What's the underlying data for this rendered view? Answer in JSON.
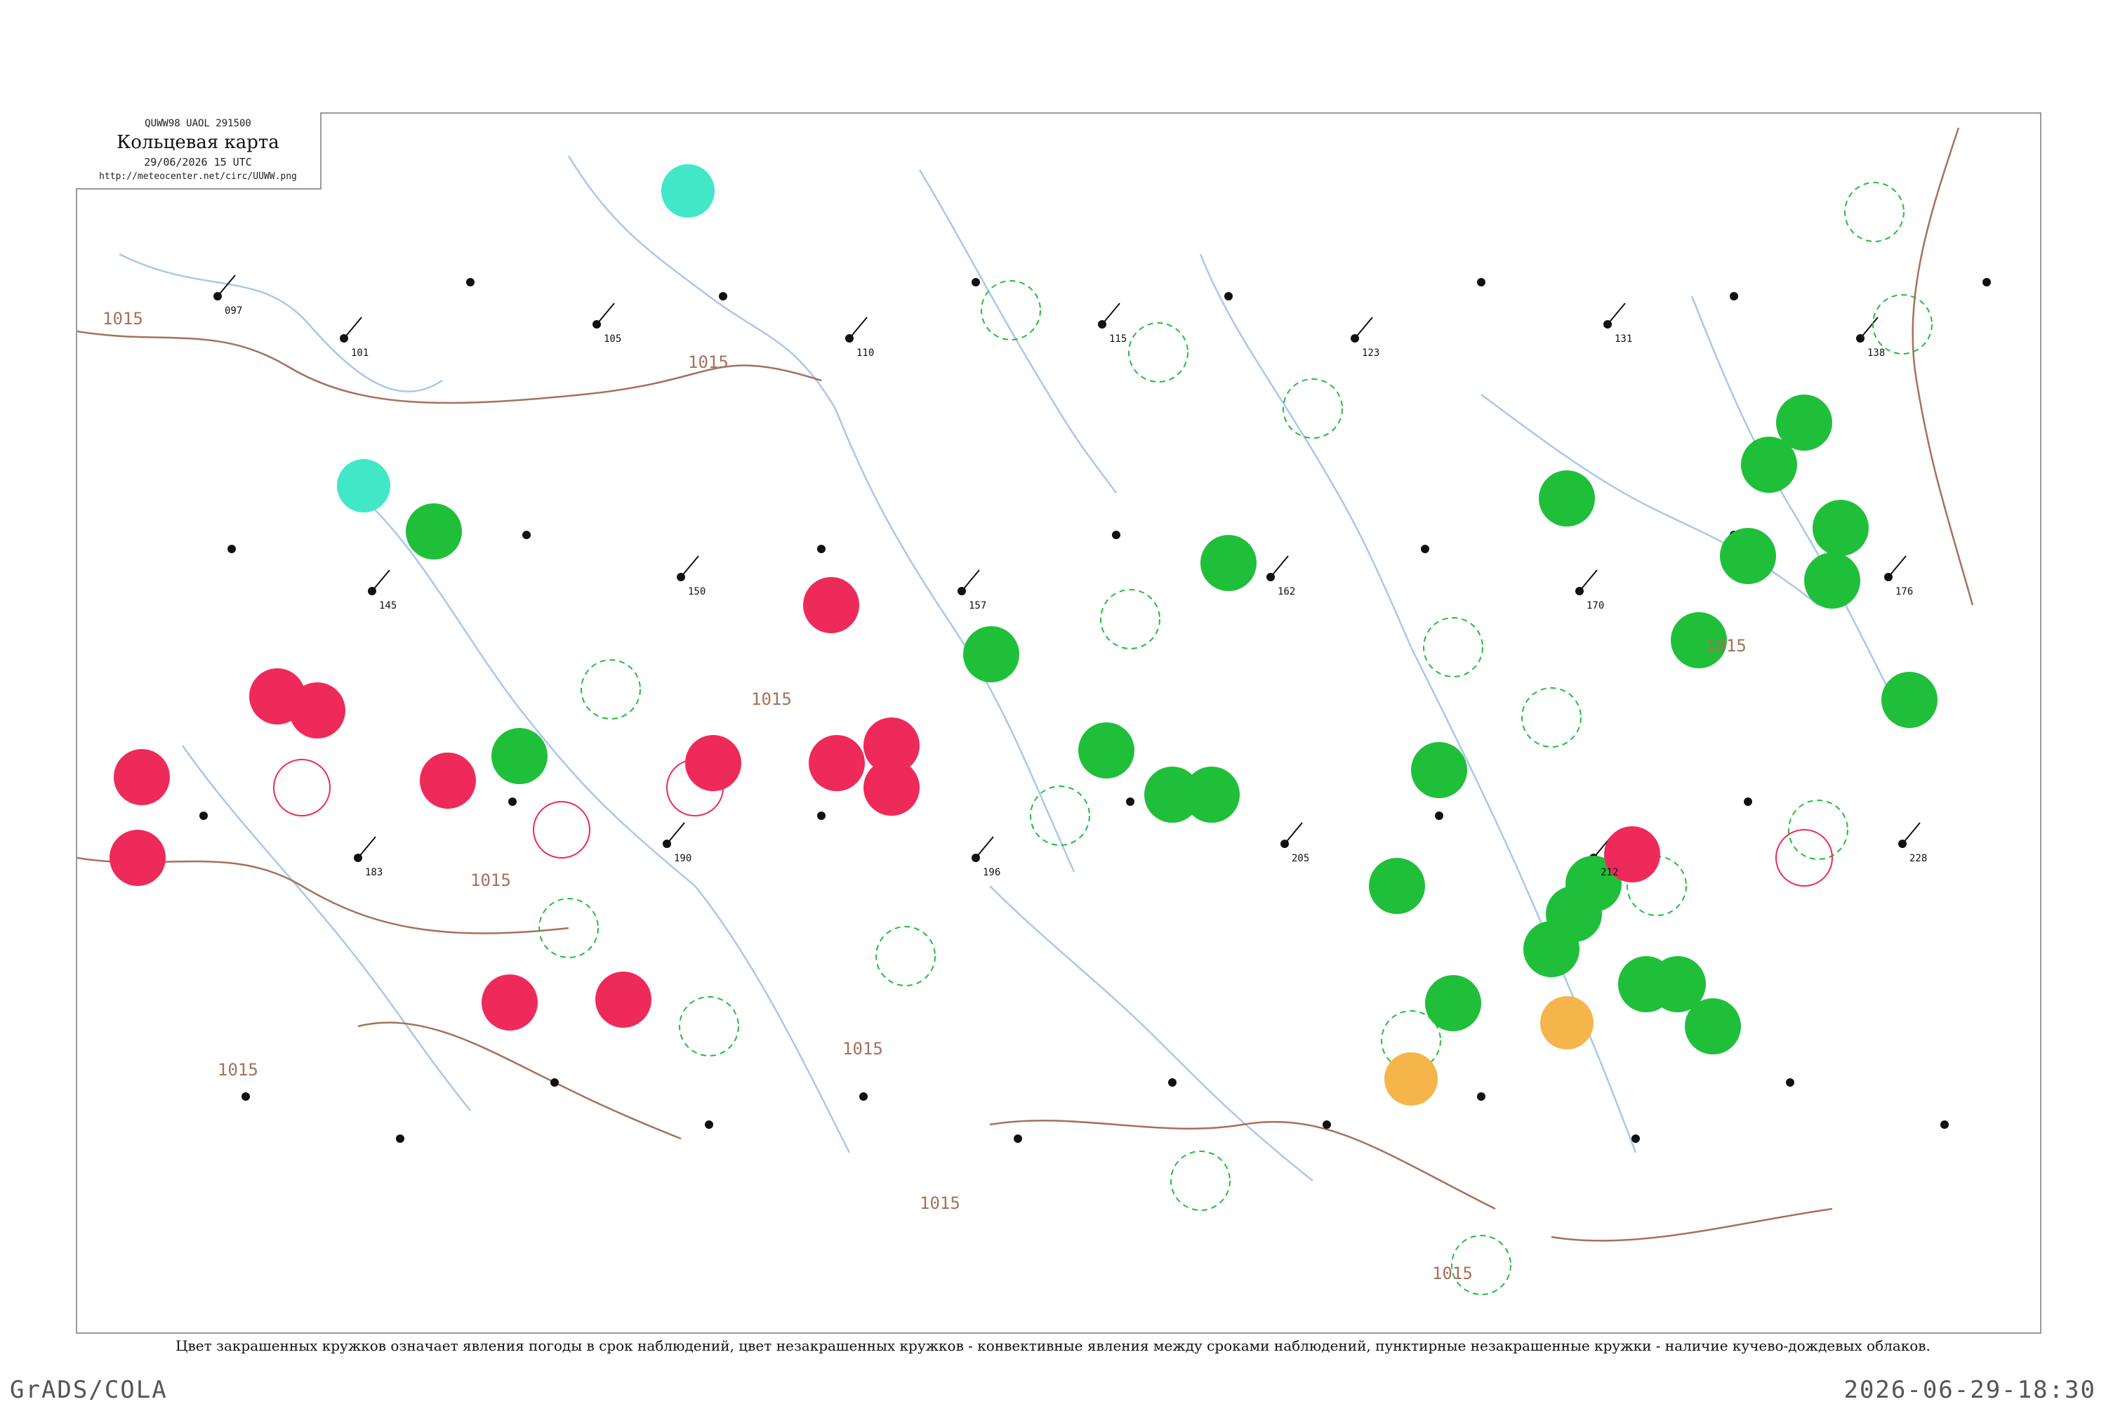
{
  "header": {
    "code_line": "QUWW98 UAOL 291500",
    "title": "Кольцевая карта",
    "time": "29/06/2026 15 UTC",
    "url": "http://meteocenter.net/circ/UUWW.png"
  },
  "caption": "Цвет закрашенных кружков означает явления погоды в срок наблюдений, цвет незакрашенных кружков - конвективные явления между сроками наблюдений, пунктирные незакрашенные кружки - наличие кучево-дождевых облаков.",
  "footer": {
    "left": "GrADS/COLA",
    "right": "2026-06-29-18:30"
  },
  "colors": {
    "rain": "#1fbf3a",
    "thunder": "#ee2a5a",
    "fog": "#40e8c8",
    "dust": "#f5b54a",
    "river": "#a8c8ec",
    "isobar": "#a8705a",
    "station": "#111111"
  },
  "isobar_labels": [
    "1015",
    "1015",
    "1015",
    "1015",
    "1015",
    "1015",
    "1015",
    "1015",
    "1015"
  ],
  "filled_circles": [
    {
      "phenomenon": "fog",
      "station": "228 / 175"
    },
    {
      "phenomenon": "fog",
      "station": "233 / 173"
    },
    {
      "phenomenon": "rain",
      "station": "262 / 260"
    },
    {
      "phenomenon": "thunder",
      "station": "229 / 183"
    },
    {
      "phenomenon": "thunder",
      "station": "281 / 200"
    },
    {
      "phenomenon": "rain",
      "station": "176 / 178"
    },
    {
      "phenomenon": "rain",
      "station": "183 / 184"
    },
    {
      "phenomenon": "dust",
      "station": "252 / 079"
    },
    {
      "phenomenon": "dust",
      "station": "233 / 043"
    }
  ],
  "station_labels": [
    "097",
    "101",
    "105",
    "110",
    "115",
    "123",
    "131",
    "138",
    "145",
    "150",
    "157",
    "162",
    "170",
    "176",
    "183",
    "190",
    "196",
    "205",
    "212",
    "228"
  ]
}
